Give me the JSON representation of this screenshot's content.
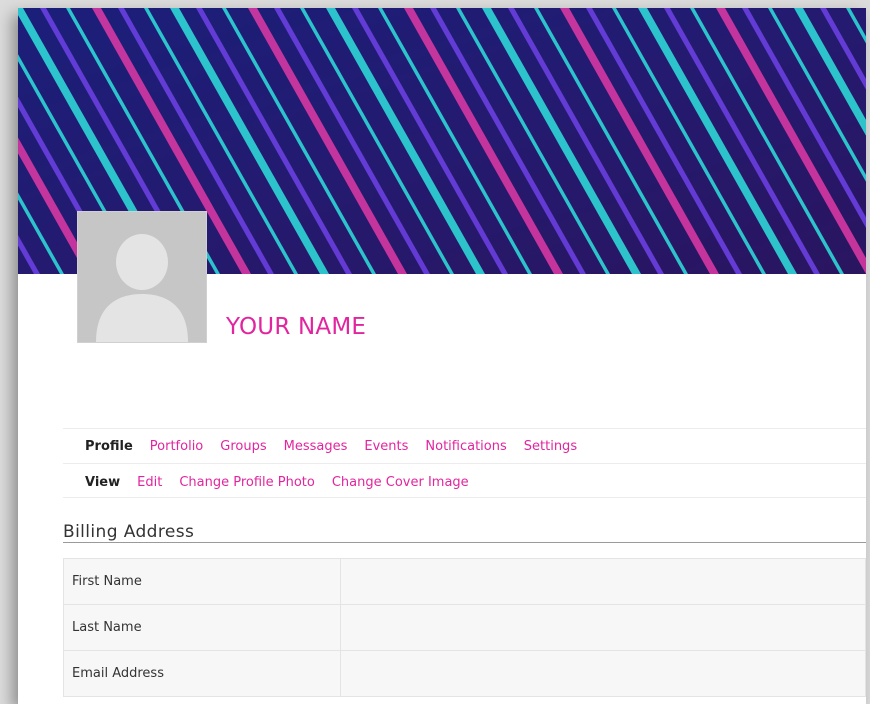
{
  "profile": {
    "name": "YOUR NAME"
  },
  "nav_primary": [
    {
      "label": "Profile",
      "active": true
    },
    {
      "label": "Portfolio",
      "active": false
    },
    {
      "label": "Groups",
      "active": false
    },
    {
      "label": "Messages",
      "active": false
    },
    {
      "label": "Events",
      "active": false
    },
    {
      "label": "Notifications",
      "active": false
    },
    {
      "label": "Settings",
      "active": false
    }
  ],
  "nav_secondary": [
    {
      "label": "View",
      "active": true
    },
    {
      "label": "Edit",
      "active": false
    },
    {
      "label": "Change Profile Photo",
      "active": false
    },
    {
      "label": "Change Cover Image",
      "active": false
    }
  ],
  "billing": {
    "heading": "Billing Address",
    "rows": [
      {
        "label": "First Name",
        "value": ""
      },
      {
        "label": "Last Name",
        "value": ""
      },
      {
        "label": "Email Address",
        "value": ""
      }
    ]
  },
  "colors": {
    "accent": "#e2259e",
    "cover_base": "#1a1a66",
    "stripe_cyan": "#2fd6d6",
    "stripe_magenta": "#e03aa6",
    "stripe_purple": "#6a3fe0"
  },
  "icons": {
    "avatar": "default-user-silhouette"
  }
}
